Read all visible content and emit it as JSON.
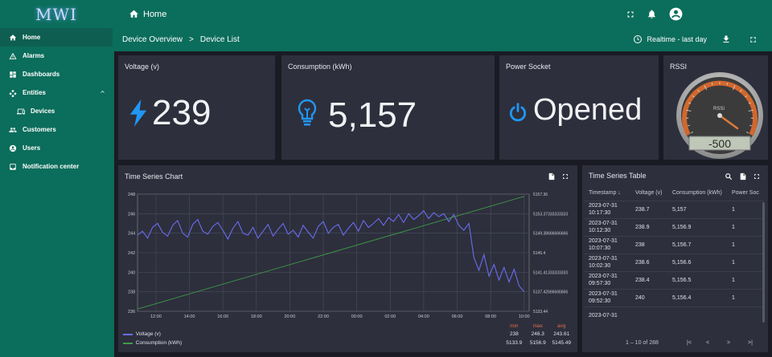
{
  "logo": {
    "text": "MWI"
  },
  "sidebar": {
    "items": [
      {
        "label": "Home",
        "icon": "home-icon"
      },
      {
        "label": "Alarms",
        "icon": "warning-icon"
      },
      {
        "label": "Dashboards",
        "icon": "dashboard-icon"
      },
      {
        "label": "Entities",
        "icon": "entities-icon"
      },
      {
        "label": "Devices",
        "icon": "devices-icon"
      },
      {
        "label": "Customers",
        "icon": "people-icon"
      },
      {
        "label": "Users",
        "icon": "user-icon"
      },
      {
        "label": "Notification center",
        "icon": "bell-icon"
      }
    ]
  },
  "header": {
    "title": "Home"
  },
  "breadcrumb": {
    "first": "Device Overview",
    "sep": ">",
    "second": "Device List"
  },
  "timewindow": {
    "label": "Realtime - last day"
  },
  "cards": {
    "voltage": {
      "title": "Voltage (v)",
      "value": "239"
    },
    "consumption": {
      "title": "Consumption (kWh)",
      "value": "5,157"
    },
    "socket": {
      "title": "Power Socket",
      "value": "Opened"
    },
    "rssi": {
      "title": "RSSI",
      "gauge_label": "RSSI",
      "value": "-50",
      "display": "-500"
    }
  },
  "chart_widget": {
    "title": "Time Series Chart",
    "legend_headers": {
      "min": "min",
      "max": "max",
      "avg": "avg"
    },
    "legend": [
      {
        "name": "Voltage (v)",
        "color": "#6a6cf0",
        "min": "238",
        "max": "246.3",
        "avg": "243.61"
      },
      {
        "name": "Consumption (kWh)",
        "color": "#3f9a48",
        "min": "5133.9",
        "max": "5156.9",
        "avg": "5145.49"
      }
    ]
  },
  "chart_data": {
    "type": "line",
    "x_ticks": [
      "12:00",
      "14:00",
      "16:00",
      "18:00",
      "20:00",
      "22:00",
      "00:00",
      "02:00",
      "04:00",
      "06:00",
      "08:00",
      "10:00"
    ],
    "y_left": {
      "ticks": [
        "248",
        "246",
        "244",
        "242",
        "240",
        "238",
        "236"
      ],
      "ylim": [
        236,
        248
      ]
    },
    "y_right": {
      "ticks": [
        "5157.36",
        "5153.37333333333",
        "5149.38666666666",
        "5145.4",
        "5141.41333333333",
        "5137.42666666666",
        "5133.44"
      ],
      "ylim": [
        5133.44,
        5157.36
      ]
    },
    "series": [
      {
        "name": "Voltage (v)",
        "axis": "left",
        "color": "#6a6cf0",
        "x": [
          10.9,
          11.2,
          11.5,
          11.8,
          12.1,
          12.4,
          12.7,
          13.0,
          13.3,
          13.6,
          13.9,
          14.2,
          14.5,
          14.8,
          15.1,
          15.4,
          15.7,
          16.0,
          16.3,
          16.6,
          16.9,
          17.2,
          17.5,
          17.8,
          18.1,
          18.4,
          18.7,
          19.0,
          19.3,
          19.6,
          19.9,
          20.2,
          20.5,
          20.8,
          21.1,
          21.4,
          21.7,
          22.0,
          22.3,
          22.6,
          22.9,
          23.2,
          23.5,
          23.8,
          24.1,
          24.4,
          24.7,
          25.0,
          25.3,
          25.6,
          25.9,
          26.2,
          26.5,
          26.8,
          27.1,
          27.4,
          27.7,
          28.0,
          28.3,
          28.6,
          28.9,
          29.2,
          29.5,
          29.8,
          30.1,
          30.4,
          30.7,
          31.0,
          31.3,
          31.6,
          31.9,
          32.2,
          32.5,
          32.8,
          33.1,
          33.4,
          33.7,
          34.0
        ],
        "values": [
          243.8,
          244.2,
          243.5,
          244.6,
          245.0,
          244.1,
          243.7,
          244.8,
          245.3,
          244.0,
          243.6,
          244.9,
          245.4,
          244.2,
          243.9,
          244.7,
          245.1,
          244.3,
          243.4,
          244.5,
          245.2,
          244.0,
          243.8,
          244.6,
          243.5,
          244.2,
          244.9,
          243.7,
          244.4,
          245.0,
          243.9,
          244.3,
          243.6,
          244.8,
          244.1,
          243.5,
          244.7,
          245.2,
          244.0,
          244.6,
          244.9,
          243.8,
          244.5,
          245.1,
          244.2,
          245.3,
          244.6,
          245.0,
          245.5,
          244.8,
          245.6,
          245.2,
          245.9,
          245.1,
          246.0,
          245.4,
          245.8,
          246.3,
          245.5,
          246.1,
          245.7,
          246.0,
          245.2,
          245.9,
          244.8,
          244.3,
          245.0,
          241.5,
          240.2,
          241.8,
          239.6,
          240.8,
          239.2,
          240.5,
          239.0,
          240.3,
          238.6,
          238.0
        ]
      },
      {
        "name": "Consumption (kWh)",
        "axis": "right",
        "color": "#3f9a48",
        "x": [
          10.9,
          34.0
        ],
        "values": [
          5133.9,
          5156.9
        ]
      }
    ],
    "xlim": [
      10.9,
      34.3
    ],
    "grid": true,
    "legend": "bottom"
  },
  "table_widget": {
    "title": "Time Series Table",
    "columns": [
      "Timestamp ↓",
      "Voltage (v)",
      "Consumption (kWh)",
      "Power Soc"
    ],
    "rows": [
      {
        "date": "2023-07-31",
        "time": "10:17:30",
        "voltage": "238.7",
        "consumption": "5,157",
        "power": "1"
      },
      {
        "date": "2023-07-31",
        "time": "10:12:30",
        "voltage": "238.9",
        "consumption": "5,156.9",
        "power": "1"
      },
      {
        "date": "2023-07-31",
        "time": "10:07:30",
        "voltage": "238",
        "consumption": "5,156.7",
        "power": "1"
      },
      {
        "date": "2023-07-31",
        "time": "10:02:30",
        "voltage": "238.6",
        "consumption": "5,156.6",
        "power": "1"
      },
      {
        "date": "2023-07-31",
        "time": "09:57:30",
        "voltage": "238.4",
        "consumption": "5,156.5",
        "power": "1"
      },
      {
        "date": "2023-07-31",
        "time": "09:52:30",
        "voltage": "240",
        "consumption": "5,156.4",
        "power": "1"
      },
      {
        "date": "2023-07-31",
        "time": "",
        "voltage": "",
        "consumption": "",
        "power": ""
      }
    ],
    "pagination": "1 – 10 of 288"
  },
  "colors": {
    "brand": "#0b6d5b",
    "card": "#2d2f3c",
    "accent_blue": "#2196f3"
  }
}
